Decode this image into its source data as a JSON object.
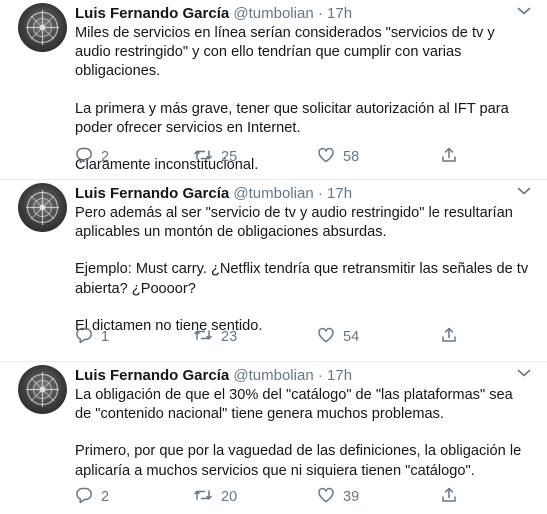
{
  "tweets": [
    {
      "name": "Luis Fernando García",
      "handle": "@tumbolian",
      "separator": "·",
      "time": "17h",
      "paragraphs": [
        "Miles de servicios en línea serían considerados \"servicios de tv y audio restringido\"  y con ello tendrían que cumplir con varias obligaciones.",
        "La primera y más grave, tener que solicitar autorización al IFT para poder ofrecer servicios en Internet.",
        "Claramente inconstitucional."
      ],
      "replies": "2",
      "retweets": "25",
      "likes": "58"
    },
    {
      "name": "Luis Fernando García",
      "handle": "@tumbolian",
      "separator": "·",
      "time": "17h",
      "paragraphs": [
        "Pero además al ser \"servicio de tv y audio restringido\" le resultarían aplicables un montón de obligaciones absurdas.",
        "Ejemplo: Must carry. ¿Netflix tendría que retransmitir las señales de tv abierta? ¿Poooor?",
        "El dictamen no tiene sentido."
      ],
      "replies": "1",
      "retweets": "23",
      "likes": "54"
    },
    {
      "name": "Luis Fernando García",
      "handle": "@tumbolian",
      "separator": "·",
      "time": "17h",
      "paragraphs": [
        "La obligación de que el 30% del \"catálogo\" de \"las plataformas\" sea de \"contenido nacional\" tiene genera muchos problemas.",
        "Primero, por que por la vaguedad de las definiciones, la obligación le aplicaría a muchos servicios que ni siquiera tienen \"catálogo\"."
      ],
      "replies": "2",
      "retweets": "20",
      "likes": "39"
    }
  ],
  "icons": {
    "reply": "reply-icon",
    "retweet": "retweet-icon",
    "like": "heart-icon",
    "share": "share-icon",
    "menu": "chevron-down-icon"
  },
  "colors": {
    "text": "#14171a",
    "secondary": "#657786",
    "divider": "#e6ecf0"
  }
}
